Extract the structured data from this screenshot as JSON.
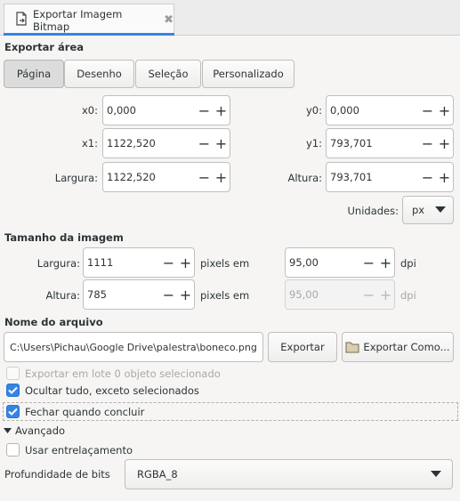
{
  "tab": {
    "title": "Exportar Imagem Bitmap",
    "icon": "document-export-icon"
  },
  "export_area": {
    "title": "Exportar área",
    "buttons": [
      "Página",
      "Desenho",
      "Seleção",
      "Personalizado"
    ],
    "active": "Página",
    "x0": {
      "label": "x0:",
      "value": "0,000"
    },
    "y0": {
      "label": "y0:",
      "value": "0,000"
    },
    "x1": {
      "label": "x1:",
      "value": "1122,520"
    },
    "y1": {
      "label": "y1:",
      "value": "793,701"
    },
    "width": {
      "label": "Largura:",
      "value": "1122,520"
    },
    "height": {
      "label": "Altura:",
      "value": "793,701"
    },
    "units": {
      "label": "Unidades:",
      "value": "px"
    }
  },
  "image_size": {
    "title": "Tamanho da imagem",
    "width": {
      "label": "Largura:",
      "value": "1111",
      "unit": "pixels em",
      "dpi": "95,00",
      "dpi_unit": "dpi"
    },
    "height": {
      "label": "Altura:",
      "value": "785",
      "unit": "pixels em",
      "dpi": "95,00",
      "dpi_unit": "dpi"
    }
  },
  "filename": {
    "title": "Nome do arquivo",
    "value": "C:\\Users\\Pichau\\Google Drive\\palestra\\boneco.png",
    "export_label": "Exportar",
    "export_as_label": "Exportar Como..."
  },
  "options": {
    "batch": {
      "label": "Exportar em lote 0 objeto selecionado",
      "checked": false,
      "enabled": false
    },
    "hide_all": {
      "label": "Ocultar tudo, exceto selecionados",
      "checked": true
    },
    "close_when_done": {
      "label": "Fechar quando concluir",
      "checked": true
    }
  },
  "advanced": {
    "title": "Avançado",
    "interlace": {
      "label": "Usar entrelaçamento",
      "checked": false
    },
    "bit_depth": {
      "label": "Profundidade de bits",
      "value": "RGBA_8"
    }
  },
  "colors": {
    "accent": "#3584e4",
    "background": "#f6f5f4"
  }
}
